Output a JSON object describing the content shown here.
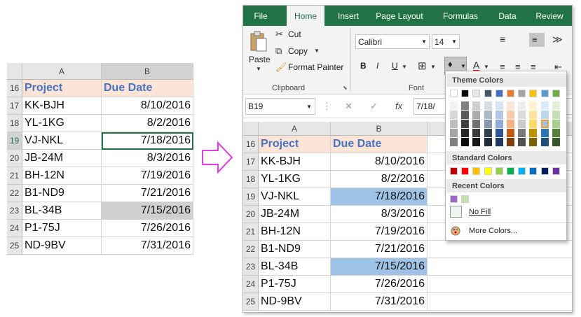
{
  "left_sheet": {
    "columns": [
      "A",
      "B"
    ],
    "rows": [
      {
        "num": "16",
        "project": "Project",
        "due": "Due Date"
      },
      {
        "num": "17",
        "project": "KK-BJH",
        "due": "8/10/2016"
      },
      {
        "num": "18",
        "project": "YL-1KG",
        "due": "8/2/2016"
      },
      {
        "num": "19",
        "project": "VJ-NKL",
        "due": "7/18/2016"
      },
      {
        "num": "20",
        "project": "JB-24M",
        "due": "8/3/2016"
      },
      {
        "num": "21",
        "project": "BH-12N",
        "due": "7/19/2016"
      },
      {
        "num": "22",
        "project": "B1-ND9",
        "due": "7/21/2016"
      },
      {
        "num": "23",
        "project": "BL-34B",
        "due": "7/15/2016"
      },
      {
        "num": "24",
        "project": "P1-75J",
        "due": "7/26/2016"
      },
      {
        "num": "25",
        "project": "ND-9BV",
        "due": "7/31/2016"
      }
    ]
  },
  "excel": {
    "tabs": [
      "File",
      "Home",
      "Insert",
      "Page Layout",
      "Formulas",
      "Data",
      "Review"
    ],
    "active_tab": "Home",
    "clipboard": {
      "paste": "Paste",
      "cut": "Cut",
      "copy": "Copy",
      "format_painter": "Format Painter",
      "label": "Clipboard"
    },
    "font": {
      "name": "Calibri",
      "size": "14",
      "bold": "B",
      "italic": "I",
      "underline": "U",
      "font_color": "A",
      "label": "Font"
    },
    "formula_bar": {
      "name_box": "B19",
      "value": "7/18/",
      "fx": "fx"
    },
    "columns": [
      "A",
      "B"
    ],
    "rows": [
      {
        "num": "16",
        "project": "Project",
        "due": "Due Date"
      },
      {
        "num": "17",
        "project": "KK-BJH",
        "due": "8/10/2016"
      },
      {
        "num": "18",
        "project": "YL-1KG",
        "due": "8/2/2016"
      },
      {
        "num": "19",
        "project": "VJ-NKL",
        "due": "7/18/2016"
      },
      {
        "num": "20",
        "project": "JB-24M",
        "due": "8/3/2016"
      },
      {
        "num": "21",
        "project": "BH-12N",
        "due": "7/19/2016"
      },
      {
        "num": "22",
        "project": "B1-ND9",
        "due": "7/21/2016"
      },
      {
        "num": "23",
        "project": "BL-34B",
        "due": "7/15/2016"
      },
      {
        "num": "24",
        "project": "P1-75J",
        "due": "7/26/2016"
      },
      {
        "num": "25",
        "project": "ND-9BV",
        "due": "7/31/2016"
      }
    ]
  },
  "color_menu": {
    "theme_colors": "Theme Colors",
    "standard_colors": "Standard Colors",
    "recent_colors": "Recent Colors",
    "no_fill": "No Fill",
    "more_colors": "More Colors...",
    "theme_top": [
      "#ffffff",
      "#000000",
      "#e7e6e6",
      "#44546a",
      "#4472c4",
      "#ed7d31",
      "#a5a5a5",
      "#ffc000",
      "#5b9bd5",
      "#70ad47"
    ],
    "theme_shades": [
      [
        "#f2f2f2",
        "#7f7f7f",
        "#d0cece",
        "#d6dce4",
        "#d9e2f3",
        "#fbe5d5",
        "#ededed",
        "#fff2cc",
        "#deebf6",
        "#e2efd9"
      ],
      [
        "#d8d8d8",
        "#595959",
        "#aeabab",
        "#adb9ca",
        "#b4c6e7",
        "#f7cbac",
        "#dbdbdb",
        "#fee599",
        "#bdd7ee",
        "#c5e0b3"
      ],
      [
        "#bfbfbf",
        "#3f3f3f",
        "#757070",
        "#8496b0",
        "#8eaadb",
        "#f4b183",
        "#c9c9c9",
        "#ffd965",
        "#9dc3e6",
        "#a8d08d"
      ],
      [
        "#a5a5a5",
        "#262626",
        "#3a3838",
        "#323f4f",
        "#2f5496",
        "#c55a11",
        "#7b7b7b",
        "#bf9000",
        "#2e75b5",
        "#538135"
      ],
      [
        "#7f7f7f",
        "#0c0c0c",
        "#171616",
        "#222a35",
        "#1f3864",
        "#833c0b",
        "#525252",
        "#7f6000",
        "#1f4e79",
        "#375623"
      ]
    ],
    "standard": [
      "#c00000",
      "#ff0000",
      "#ffc000",
      "#ffff00",
      "#92d050",
      "#00b050",
      "#00b0f0",
      "#0070c0",
      "#002060",
      "#7030a0"
    ],
    "recent": [
      "#a066cc",
      "#c6e0b4"
    ],
    "accent_green": "#217346",
    "highlight_blue": "#9dc3e6"
  }
}
